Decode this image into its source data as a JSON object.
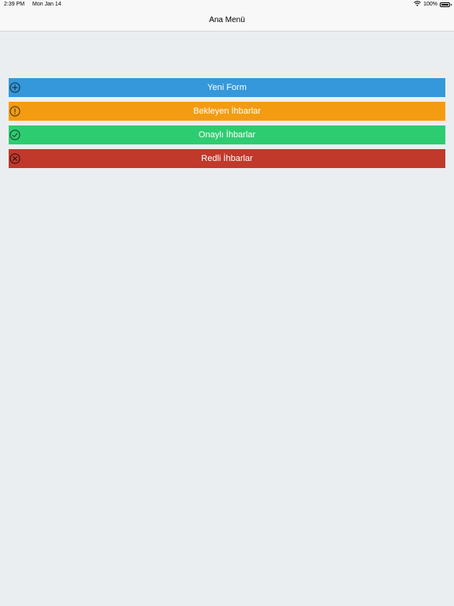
{
  "status_bar": {
    "time": "2:39 PM",
    "date": "Mon Jan 14",
    "battery": "100%"
  },
  "nav": {
    "title": "Ana Menü"
  },
  "menu": {
    "items": [
      {
        "label": "Yeni Form",
        "icon": "plus-circle-icon",
        "color": "#3498db"
      },
      {
        "label": "Bekleyen İhbarlar",
        "icon": "exclamation-circle-icon",
        "color": "#f39c12"
      },
      {
        "label": "Onaylı İhbarlar",
        "icon": "check-circle-icon",
        "color": "#2ecc71"
      },
      {
        "label": "Redli İhbarlar",
        "icon": "x-circle-icon",
        "color": "#c0392b"
      }
    ]
  }
}
